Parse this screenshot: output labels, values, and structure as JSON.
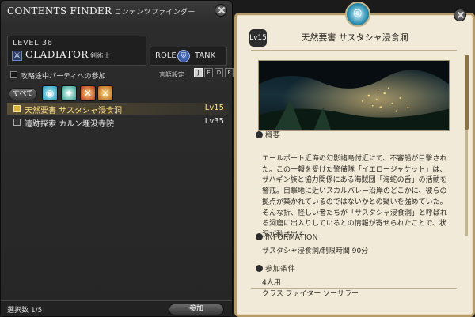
{
  "left": {
    "title": "CONTENTS FINDER",
    "title_jp": "コンテンツファインダー",
    "level": "LEVEL 36",
    "job_icon": "crossed-swords-icon",
    "job_name": "GLADIATOR",
    "job_name_jp": "剣術士",
    "role_label": "ROLE",
    "role_icon": "shield-icon",
    "role_value": "TANK",
    "unsync_label": "攻略途中パーティへの参加",
    "lang_label": "言語設定",
    "lang_buttons": [
      "J",
      "E",
      "D",
      "F"
    ],
    "all_button": "すべて",
    "duties": [
      {
        "name": "天然要害 サスタシャ浸食洞",
        "level": "Lv15",
        "selected": true
      },
      {
        "name": "遺跡探索 カルン埋没寺院",
        "level": "Lv35",
        "selected": false
      }
    ],
    "selection_count": "選択数 1/5",
    "join_button": "参加"
  },
  "right": {
    "level_badge": "Lv15",
    "title": "天然要害 サスタシャ浸食洞",
    "overview_heading": "概要",
    "overview": "エールポート近海の幻影諸島付近にて、不審船が目撃された。この一報を受けた警備隊「イエロージャケット」は、サハギン族と協力関係にある海賊団「海蛇の舌」の活動を警戒。目撃地に近いスカルバレー沿岸のどこかに、彼らの拠点が築かれているのではないかとの疑いを強めていた。\nそんな折、怪しい者たちが「サスタシャ浸食洞」と呼ばれる洞窟に出入りしているとの情報が寄せられたことで、状況が動き出す。",
    "info_heading": "INFORMATION",
    "info": "サスタシャ浸食洞/制限時間 90分",
    "cond_heading": "参加条件",
    "cond_line1": "4人用",
    "cond_line2": "クラス ファイター ソーサラー"
  }
}
